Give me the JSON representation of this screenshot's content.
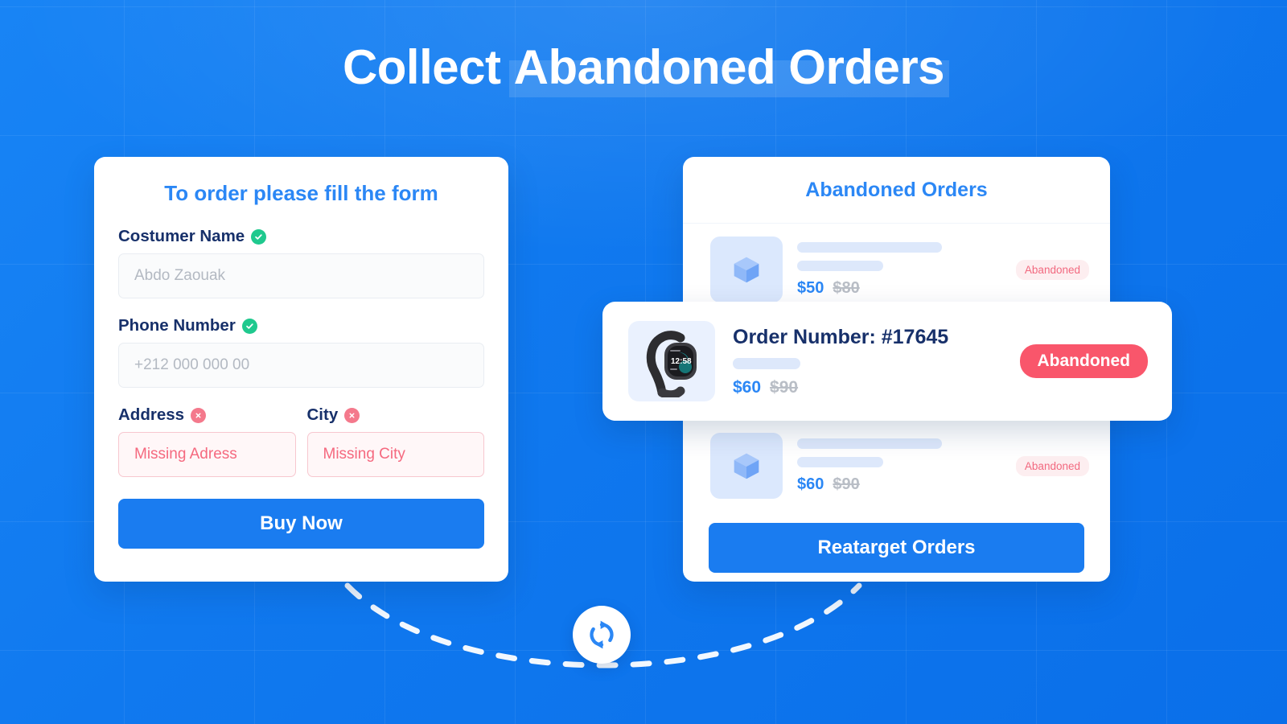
{
  "page": {
    "title_lead": "Collect ",
    "title_highlight": "Abandoned Orders",
    "background_color": "#0f78ef",
    "accent_blue": "#1a7cf0",
    "accent_coral": "#f9566b",
    "accent_green": "#1fc98e"
  },
  "form_card": {
    "title": "To order please fill the form",
    "fields": [
      {
        "label": "Costumer Name",
        "status": "valid",
        "status_icon": "check-circle-icon",
        "placeholder": "Abdo Zaouak",
        "value": ""
      },
      {
        "label": "Phone Number",
        "status": "valid",
        "status_icon": "check-circle-icon",
        "placeholder": "+212 000 000 00",
        "value": ""
      },
      {
        "label": "Address",
        "status": "error",
        "status_icon": "x-circle-icon",
        "placeholder": "Missing Adress",
        "value": ""
      },
      {
        "label": "City",
        "status": "error",
        "status_icon": "x-circle-icon",
        "placeholder": "Missing City",
        "value": ""
      }
    ],
    "submit_label": "Buy Now"
  },
  "orders_card": {
    "title": "Abandoned Orders",
    "rows": [
      {
        "thumb_icon": "box-cube-icon",
        "price_new": "$50",
        "price_old": "$80",
        "badge": "Abandoned"
      },
      {
        "thumb_icon": "box-cube-icon",
        "price_new": "$60",
        "price_old": "$90",
        "badge": "Abandoned"
      }
    ],
    "action_label": "Reatarget Orders"
  },
  "featured_order": {
    "thumb_icon": "smartwatch-image",
    "watch_time": "12:58",
    "order_number": "Order Number: #17645",
    "price_new": "$60",
    "price_old": "$90",
    "badge": "Abandoned"
  },
  "connector": {
    "icon": "sync-refresh-icon",
    "style": "dashed-curve"
  }
}
